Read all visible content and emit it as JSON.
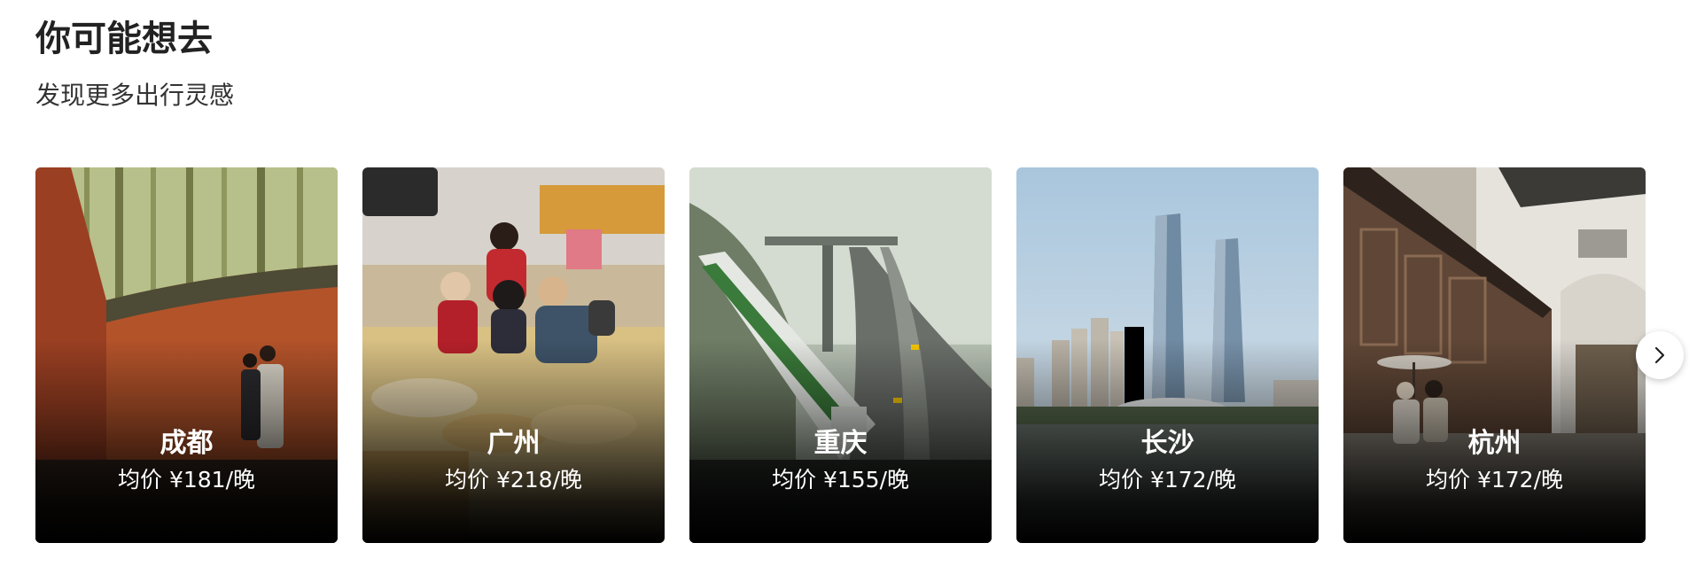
{
  "section": {
    "title": "你可能想去",
    "subtitle": "发现更多出行灵感"
  },
  "destinations": [
    {
      "name": "成都",
      "price": "均价 ¥181/晚",
      "scene": "bamboo-and-red-wall"
    },
    {
      "name": "广州",
      "price": "均价 ¥218/晚",
      "scene": "street-market-tourists"
    },
    {
      "name": "重庆",
      "price": "均价 ¥155/晚",
      "scene": "monorail-and-highway"
    },
    {
      "name": "长沙",
      "price": "均价 ¥172/晚",
      "scene": "twin-towers-skyline"
    },
    {
      "name": "杭州",
      "price": "均价 ¥172/晚",
      "scene": "traditional-courtyard"
    }
  ],
  "controls": {
    "next_icon": "chevron-right-icon"
  },
  "colors": {
    "text_primary": "#222222",
    "card_overlay": "#000000",
    "button_bg": "#ffffff"
  }
}
